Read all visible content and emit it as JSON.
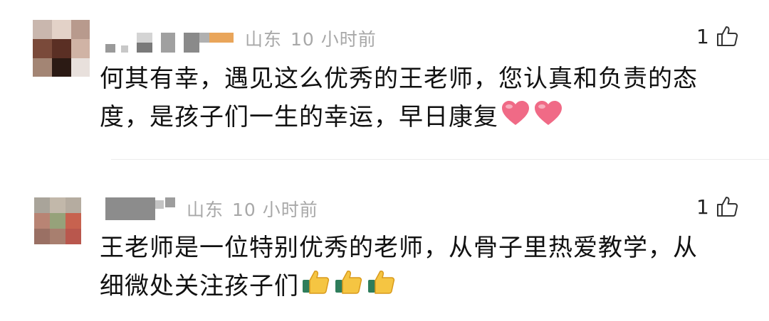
{
  "comments": [
    {
      "location": "山东",
      "time": "10 小时前",
      "likes": "1",
      "line1": "何其有幸，遇见这么优秀的王老师，您认真和负责的态",
      "line2": "度，是孩子们一生的幸运，早日康复",
      "emoji": "heart-emoji",
      "emoji_count": 2
    },
    {
      "location": "山东",
      "time": "10 小时前",
      "likes": "1",
      "line1": "王老师是一位特别优秀的老师，从骨子里热爱教学，从",
      "line2": "细微处关注孩子们",
      "emoji": "thumbs-up-emoji",
      "emoji_count": 3
    }
  ],
  "colors": {
    "meta_text": "#a8a8a8",
    "heart": "#f06a86",
    "thumbs": "#f5c542"
  }
}
